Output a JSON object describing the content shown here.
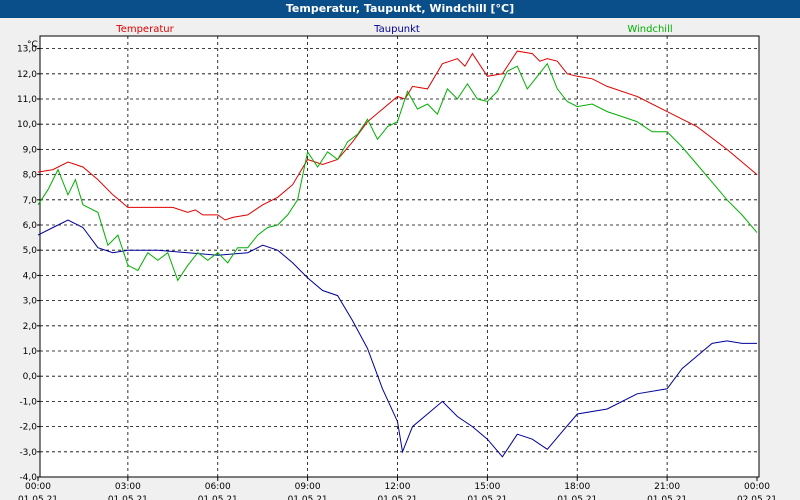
{
  "window": {
    "title": "Temperatur, Taupunkt, Windchill [°C]"
  },
  "chart_data": {
    "type": "line",
    "title": "Temperatur, Taupunkt, Windchill [°C]",
    "ylabel": "°C",
    "ylim": [
      -4.0,
      13.5
    ],
    "y_ticks": [
      "13,0",
      "12,0",
      "11,0",
      "10,0",
      "9,0",
      "8,0",
      "7,0",
      "6,0",
      "5,0",
      "4,0",
      "3,0",
      "2,0",
      "1,0",
      "0,0",
      "-1,0",
      "-2,0",
      "-3,0",
      "-4,0"
    ],
    "x_ticks": [
      {
        "time": "00:00",
        "date": "01.05.21"
      },
      {
        "time": "03:00",
        "date": "01.05.21"
      },
      {
        "time": "06:00",
        "date": "01.05.21"
      },
      {
        "time": "09:00",
        "date": "01.05.21"
      },
      {
        "time": "12:00",
        "date": "01.05.21"
      },
      {
        "time": "15:00",
        "date": "01.05.21"
      },
      {
        "time": "18:00",
        "date": "01.05.21"
      },
      {
        "time": "21:00",
        "date": "01.05.21"
      },
      {
        "time": "00:00",
        "date": "02.05.21"
      }
    ],
    "xlim": [
      "01.05.21 00:00",
      "02.05.21 00:00"
    ],
    "grid": true,
    "legend": "top",
    "series": [
      {
        "name": "Temperatur",
        "color": "#e00000",
        "points": [
          [
            "00:00",
            8.1
          ],
          [
            "00:30",
            8.2
          ],
          [
            "01:00",
            8.5
          ],
          [
            "01:30",
            8.3
          ],
          [
            "02:00",
            7.8
          ],
          [
            "02:30",
            7.2
          ],
          [
            "03:00",
            6.7
          ],
          [
            "03:30",
            6.7
          ],
          [
            "04:00",
            6.7
          ],
          [
            "04:30",
            6.7
          ],
          [
            "05:00",
            6.5
          ],
          [
            "05:15",
            6.6
          ],
          [
            "05:30",
            6.4
          ],
          [
            "06:00",
            6.4
          ],
          [
            "06:15",
            6.2
          ],
          [
            "06:30",
            6.3
          ],
          [
            "07:00",
            6.4
          ],
          [
            "07:30",
            6.8
          ],
          [
            "08:00",
            7.1
          ],
          [
            "08:30",
            7.6
          ],
          [
            "09:00",
            8.6
          ],
          [
            "09:30",
            8.4
          ],
          [
            "10:00",
            8.6
          ],
          [
            "10:30",
            9.3
          ],
          [
            "11:00",
            10.1
          ],
          [
            "11:30",
            10.6
          ],
          [
            "12:00",
            11.1
          ],
          [
            "12:15",
            11.0
          ],
          [
            "12:30",
            11.5
          ],
          [
            "13:00",
            11.4
          ],
          [
            "13:30",
            12.4
          ],
          [
            "14:00",
            12.6
          ],
          [
            "14:15",
            12.3
          ],
          [
            "14:30",
            12.8
          ],
          [
            "15:00",
            11.9
          ],
          [
            "15:30",
            12.0
          ],
          [
            "16:00",
            12.9
          ],
          [
            "16:30",
            12.8
          ],
          [
            "16:45",
            12.5
          ],
          [
            "17:00",
            12.6
          ],
          [
            "17:20",
            12.5
          ],
          [
            "17:40",
            12.0
          ],
          [
            "18:00",
            11.9
          ],
          [
            "18:30",
            11.8
          ],
          [
            "19:00",
            11.5
          ],
          [
            "20:00",
            11.1
          ],
          [
            "21:00",
            10.5
          ],
          [
            "22:00",
            9.9
          ],
          [
            "23:00",
            9.0
          ],
          [
            "23:30",
            8.5
          ],
          [
            "24:00",
            8.0
          ]
        ]
      },
      {
        "name": "Taupunkt",
        "color": "#000099",
        "points": [
          [
            "00:00",
            5.6
          ],
          [
            "00:30",
            5.9
          ],
          [
            "01:00",
            6.2
          ],
          [
            "01:30",
            5.9
          ],
          [
            "02:00",
            5.1
          ],
          [
            "02:30",
            4.9
          ],
          [
            "03:00",
            5.0
          ],
          [
            "04:00",
            5.0
          ],
          [
            "05:00",
            4.9
          ],
          [
            "06:00",
            4.8
          ],
          [
            "07:00",
            4.9
          ],
          [
            "07:30",
            5.2
          ],
          [
            "08:00",
            5.0
          ],
          [
            "08:30",
            4.5
          ],
          [
            "09:00",
            3.9
          ],
          [
            "09:30",
            3.4
          ],
          [
            "10:00",
            3.2
          ],
          [
            "10:30",
            2.2
          ],
          [
            "11:00",
            1.1
          ],
          [
            "11:30",
            -0.5
          ],
          [
            "12:00",
            -1.8
          ],
          [
            "12:10",
            -3.0
          ],
          [
            "12:30",
            -2.0
          ],
          [
            "13:00",
            -1.5
          ],
          [
            "13:30",
            -1.0
          ],
          [
            "14:00",
            -1.6
          ],
          [
            "14:30",
            -2.0
          ],
          [
            "15:00",
            -2.5
          ],
          [
            "15:30",
            -3.2
          ],
          [
            "16:00",
            -2.3
          ],
          [
            "16:30",
            -2.5
          ],
          [
            "17:00",
            -2.9
          ],
          [
            "17:30",
            -2.2
          ],
          [
            "18:00",
            -1.5
          ],
          [
            "19:00",
            -1.3
          ],
          [
            "20:00",
            -0.7
          ],
          [
            "21:00",
            -0.5
          ],
          [
            "21:30",
            0.3
          ],
          [
            "22:00",
            0.8
          ],
          [
            "22:30",
            1.3
          ],
          [
            "23:00",
            1.4
          ],
          [
            "23:30",
            1.3
          ],
          [
            "24:00",
            1.3
          ]
        ]
      },
      {
        "name": "Windchill",
        "color": "#00b000",
        "points": [
          [
            "00:00",
            6.8
          ],
          [
            "00:20",
            7.4
          ],
          [
            "00:40",
            8.2
          ],
          [
            "01:00",
            7.2
          ],
          [
            "01:15",
            7.8
          ],
          [
            "01:30",
            6.8
          ],
          [
            "02:00",
            6.5
          ],
          [
            "02:20",
            5.2
          ],
          [
            "02:40",
            5.6
          ],
          [
            "03:00",
            4.4
          ],
          [
            "03:20",
            4.2
          ],
          [
            "03:40",
            4.9
          ],
          [
            "04:00",
            4.6
          ],
          [
            "04:20",
            4.9
          ],
          [
            "04:40",
            3.8
          ],
          [
            "05:00",
            4.4
          ],
          [
            "05:20",
            4.9
          ],
          [
            "05:40",
            4.6
          ],
          [
            "06:00",
            4.9
          ],
          [
            "06:20",
            4.5
          ],
          [
            "06:40",
            5.1
          ],
          [
            "07:00",
            5.1
          ],
          [
            "07:20",
            5.6
          ],
          [
            "07:40",
            5.9
          ],
          [
            "08:00",
            6.0
          ],
          [
            "08:20",
            6.4
          ],
          [
            "08:40",
            7.0
          ],
          [
            "09:00",
            8.9
          ],
          [
            "09:20",
            8.3
          ],
          [
            "09:40",
            8.9
          ],
          [
            "10:00",
            8.6
          ],
          [
            "10:20",
            9.3
          ],
          [
            "10:40",
            9.6
          ],
          [
            "11:00",
            10.2
          ],
          [
            "11:20",
            9.4
          ],
          [
            "11:40",
            9.9
          ],
          [
            "12:00",
            10.1
          ],
          [
            "12:20",
            11.3
          ],
          [
            "12:40",
            10.6
          ],
          [
            "13:00",
            10.8
          ],
          [
            "13:20",
            10.4
          ],
          [
            "13:40",
            11.4
          ],
          [
            "14:00",
            11.0
          ],
          [
            "14:20",
            11.6
          ],
          [
            "14:40",
            11.0
          ],
          [
            "15:00",
            10.9
          ],
          [
            "15:20",
            11.3
          ],
          [
            "15:40",
            12.1
          ],
          [
            "16:00",
            12.3
          ],
          [
            "16:20",
            11.4
          ],
          [
            "16:40",
            11.9
          ],
          [
            "17:00",
            12.4
          ],
          [
            "17:20",
            11.4
          ],
          [
            "17:40",
            10.9
          ],
          [
            "18:00",
            10.7
          ],
          [
            "18:30",
            10.8
          ],
          [
            "19:00",
            10.5
          ],
          [
            "19:30",
            10.3
          ],
          [
            "20:00",
            10.1
          ],
          [
            "20:30",
            9.7
          ],
          [
            "21:00",
            9.7
          ],
          [
            "21:30",
            9.1
          ],
          [
            "22:00",
            8.4
          ],
          [
            "22:30",
            7.7
          ],
          [
            "23:00",
            7.0
          ],
          [
            "23:30",
            6.4
          ],
          [
            "24:00",
            5.7
          ]
        ]
      }
    ]
  }
}
